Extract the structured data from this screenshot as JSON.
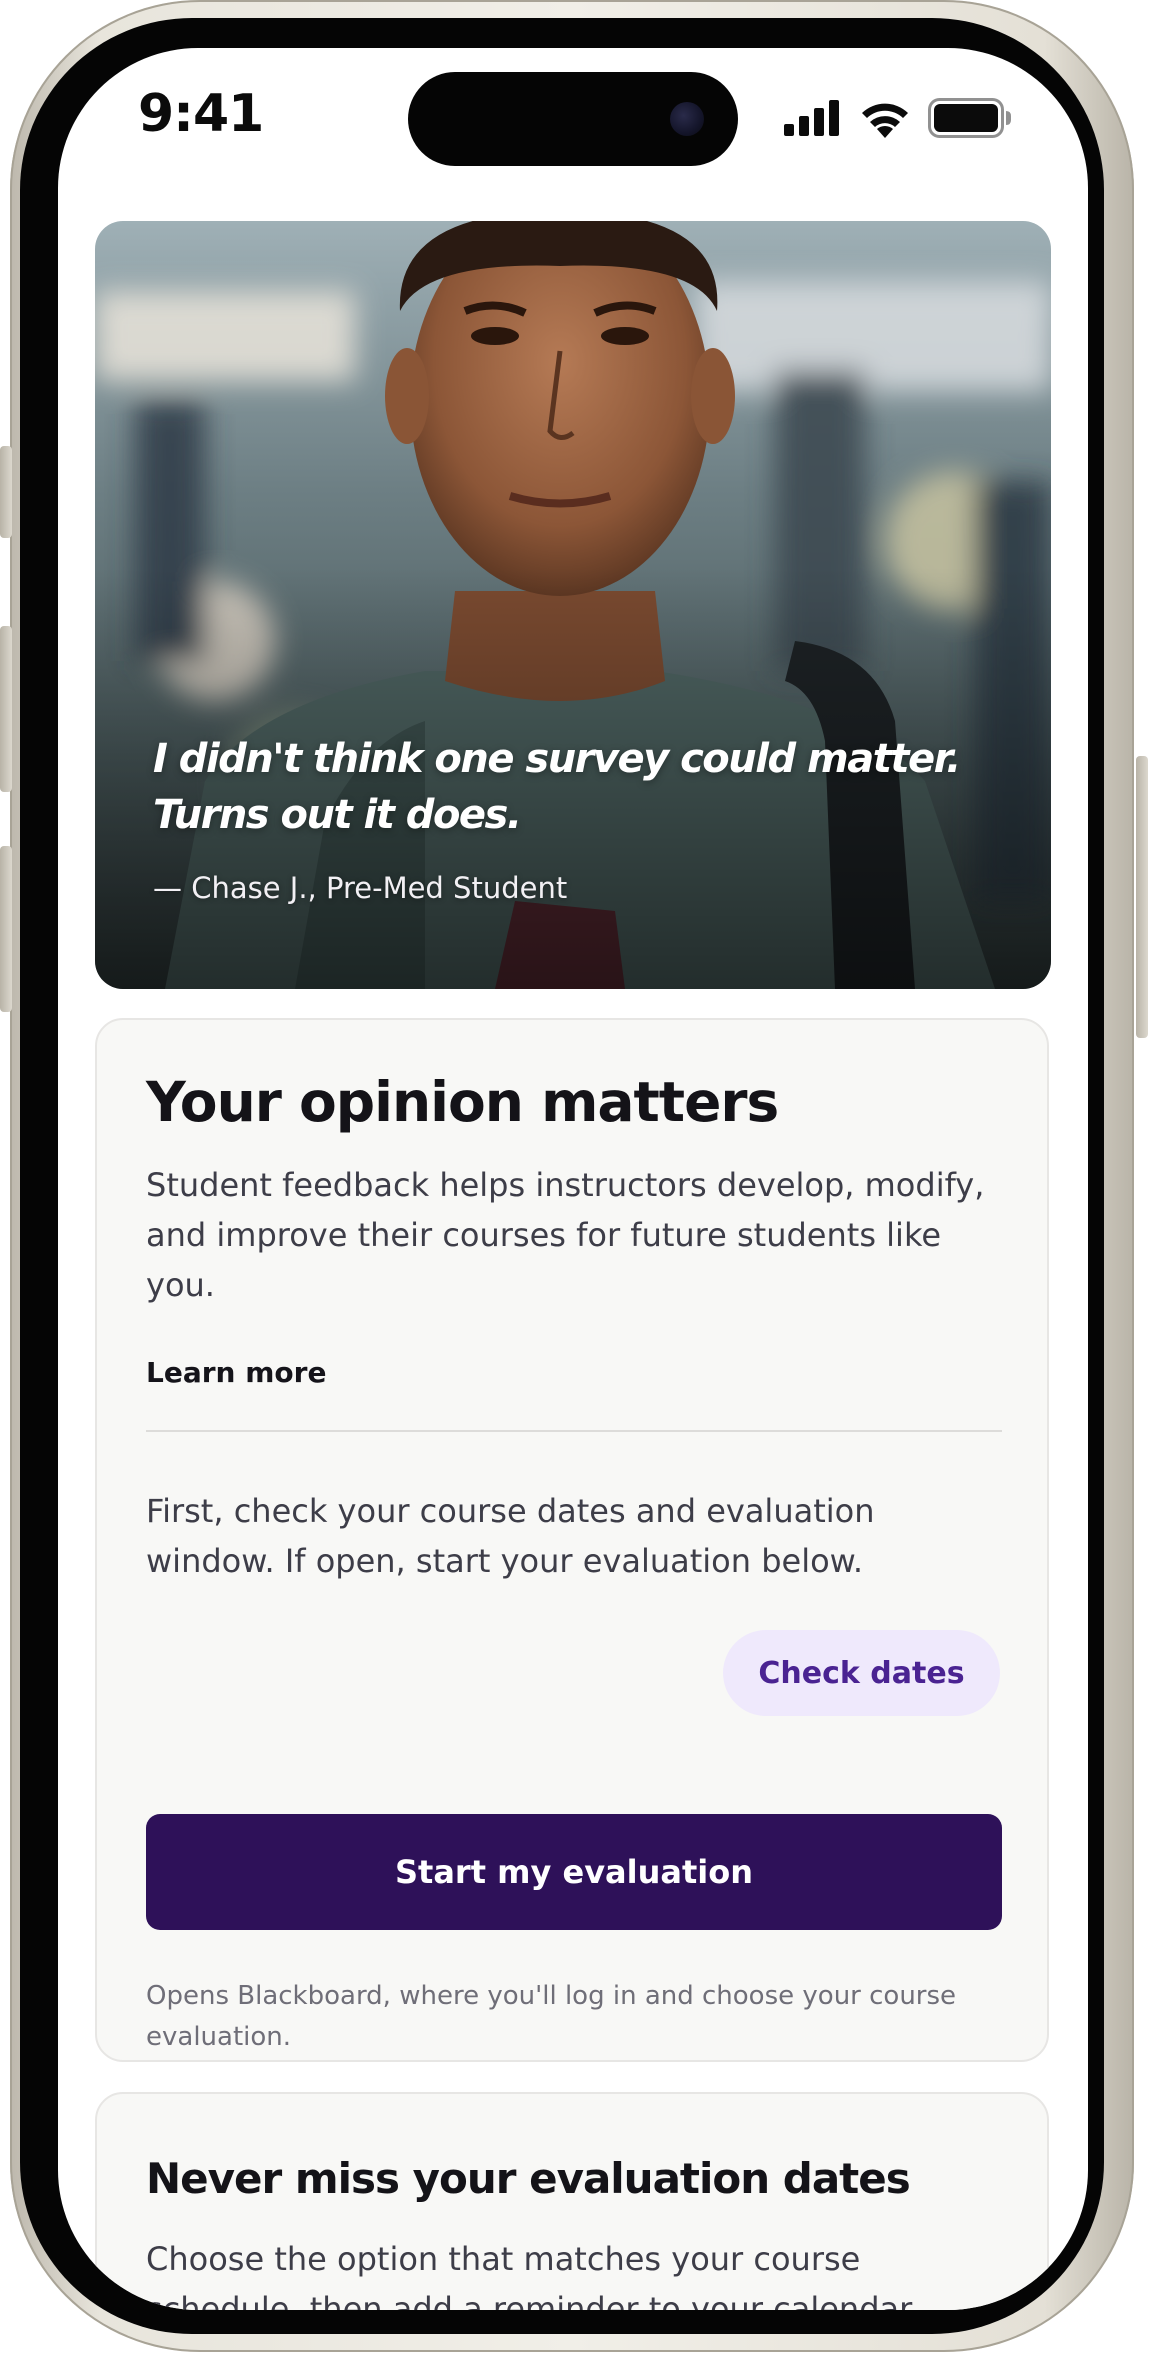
{
  "status_bar": {
    "time": "9:41",
    "icons": [
      "cellular-signal-icon",
      "wifi-icon",
      "battery-icon"
    ]
  },
  "hero": {
    "quote": "I didn't think one survey could matter. Turns out it does.",
    "attribution": "— Chase J., Pre-Med Student"
  },
  "card_opinion": {
    "title": "Your opinion matters",
    "description": "Student feedback helps instructors develop, modify, and improve their courses for future students like you.",
    "learn_more": "Learn more",
    "instructions": "First, check your course dates and evaluation window. If open, start your evaluation below.",
    "check_dates_label": "Check dates",
    "start_label": "Start my evaluation",
    "note": "Opens Blackboard, where you'll log in and choose your course evaluation."
  },
  "card_dates": {
    "title": "Never miss your evaluation dates",
    "description": "Choose the option that matches your course schedule, then add a reminder to your calendar."
  },
  "colors": {
    "primary": "#2e1159",
    "chip_bg": "#efe9fc",
    "chip_text": "#4a2392",
    "card_bg": "#f8f8f6"
  }
}
